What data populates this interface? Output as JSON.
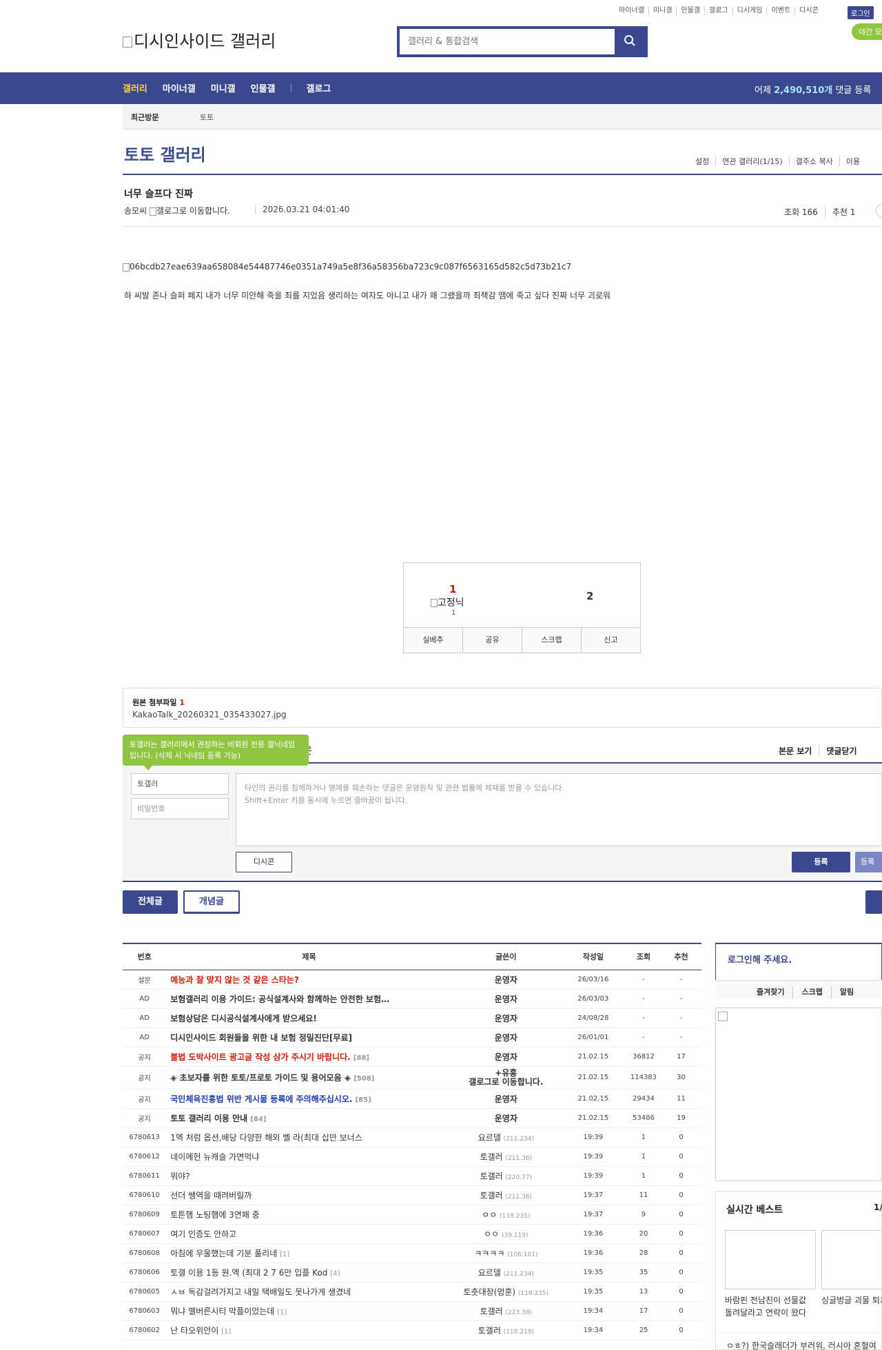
{
  "header": {
    "top_links": [
      "마이너갤",
      "미니갤",
      "인물갤",
      "갤로그",
      "디시게임",
      "이벤트",
      "디시콘"
    ],
    "login": "로그인",
    "night_mode": "야간 모드",
    "logo_alt": "디시인사이드 갤러리",
    "search_placeholder": "갤러리 & 통합검색"
  },
  "nav": {
    "items": [
      "갤러리",
      "마이너갤",
      "미니갤",
      "인물갤",
      "갤로그"
    ],
    "comment_count_prefix": "어제 ",
    "comment_count_value": "2,490,510개",
    "comment_count_suffix": " 댓글 등록"
  },
  "recent": {
    "label": "최근방문",
    "item": "토토"
  },
  "gallery": {
    "title": "토토 갤러리",
    "tools": [
      "설정",
      "연관 갤러리(1/15)",
      "갤주소 복사",
      "이용"
    ]
  },
  "post": {
    "title": "너무 슬프다 진짜",
    "author": "송모씨 ",
    "author_alt": "갤로그로 이동합니다.",
    "date": "2026.03.21 04:01:40",
    "views": "조회 166",
    "recommend": "추천 1",
    "image_alt": "06bcdb27eae639aa658084e54487746e0351a749a5e8f36a58356ba723c9c087f6563165d582c5d73b21c7",
    "body": "하 씨발 존나 슬퍼 페지 내가 너무 미안해 죽을 죄를 지었음 생리하는 여자도 아니고 내가 왜 그랬을까 죄책감 땜에 죽고 싶다 진짜 너무 괴로워"
  },
  "recommend_box": {
    "up_count": "1",
    "fixed_alt": "고정닉",
    "fixed_count": "1",
    "down_count": "2",
    "buttons": [
      "실베추",
      "공유",
      "스크랩",
      "신고"
    ]
  },
  "attachments": {
    "label": "원본 첨부파일 ",
    "count": "1",
    "file": "KakaoTalk_20260321_035433027.jpg"
  },
  "comment": {
    "tooltip": "토갤러는 갤러리에서 권장하는 비회원 전용 갤닉네임입니다. (삭제 시 닉네임 등록 가능)",
    "head_fragment": "은",
    "tools": [
      "본문 보기",
      "댓글닫기"
    ],
    "nickname": "토갤러",
    "password_placeholder": "비밀번호",
    "textarea_line1": "타인의 권리를 침해하거나 명예를 훼손하는 댓글은 운영원칙 및 관련 법률에 제재를 받을 수 있습니다.",
    "textarea_line2": "Shift+Enter 키를 동시에 누르면 줄바꿈이 됩니다.",
    "dccon": "디시콘",
    "submit": "등록",
    "submit2": "등록"
  },
  "list": {
    "tabs": [
      "전체글",
      "개념글"
    ],
    "headers": [
      "번호",
      "제목",
      "글쓴이",
      "작성일",
      "조회",
      "추천"
    ],
    "rows": [
      {
        "num": "설문",
        "title": "예능과 잘 맞지 않는 것 같은 스타는?",
        "reply": "",
        "writer": "운영자",
        "ip": "",
        "date": "26/03/16",
        "views": "-",
        "rec": "-",
        "style": "red",
        "notice": true
      },
      {
        "num": "AD",
        "title": "보험갤러리 이용 가이드: 공식설계사와 함께하는 안전한 보험…",
        "reply": "",
        "writer": "운영자",
        "ip": "",
        "date": "26/03/03",
        "views": "-",
        "rec": "-",
        "style": "",
        "notice": true
      },
      {
        "num": "AD",
        "title": "보험상담은 디시공식설계사에게 받으세요!",
        "reply": "",
        "writer": "운영자",
        "ip": "",
        "date": "24/08/28",
        "views": "-",
        "rec": "-",
        "style": "",
        "notice": true
      },
      {
        "num": "AD",
        "title": "디시인사이드 회원들을 위한 내 보험 정밀진단[무료]",
        "reply": "",
        "writer": "운영자",
        "ip": "",
        "date": "26/01/01",
        "views": "-",
        "rec": "-",
        "style": "",
        "notice": true
      },
      {
        "num": "공지",
        "title": "불법 도박사이트 광고글 작성 삼가 주시기 바랍니다.",
        "reply": "[88]",
        "writer": "운영자",
        "ip": "",
        "date": "21.02.15",
        "views": "36812",
        "rec": "17",
        "style": "red",
        "notice": true
      },
      {
        "num": "공지",
        "title": "◈ 초보자를 위한 토토/프로토 가이드 및 용어모음 ◈",
        "reply": "[508]",
        "writer": "+유흥",
        "writer2": "갤로그로 이동합니다.",
        "ip": "",
        "date": "21.02.15",
        "views": "114383",
        "rec": "30",
        "style": "",
        "notice": true,
        "tall": true
      },
      {
        "num": "공지",
        "title": "국민체육진흥법 위반 게시물 등록에 주의해주십시오.",
        "reply": "[85]",
        "writer": "운영자",
        "ip": "",
        "date": "21.02.15",
        "views": "29434",
        "rec": "11",
        "style": "blue",
        "notice": true
      },
      {
        "num": "공지",
        "title": "토토 갤러리 이용 안내",
        "reply": "[84]",
        "writer": "운영자",
        "ip": "",
        "date": "21.02.15",
        "views": "53486",
        "rec": "19",
        "style": "",
        "notice": true
      },
      {
        "num": "6780613",
        "title": "1엑 처럼 옵션,배당 다양한 해외 벨 라(최대 십만 보너스",
        "reply": "",
        "writer": "요르델",
        "ip": "(211.234)",
        "date": "19:39",
        "views": "1",
        "rec": "0",
        "style": "",
        "notice": false
      },
      {
        "num": "6780612",
        "title": "네이메헌 뉴캐슬 가면먹냐",
        "reply": "",
        "writer": "토갤러",
        "ip": "(211.36)",
        "date": "19:39",
        "views": "1",
        "rec": "0",
        "style": "",
        "notice": false
      },
      {
        "num": "6780611",
        "title": "뭐야?",
        "reply": "",
        "writer": "토갤러",
        "ip": "(220.77)",
        "date": "19:39",
        "views": "1",
        "rec": "0",
        "style": "",
        "notice": false
      },
      {
        "num": "6780610",
        "title": "선더 쌩역을 때려버릴까",
        "reply": "",
        "writer": "토갤러",
        "ip": "(211.36)",
        "date": "19:37",
        "views": "11",
        "rec": "0",
        "style": "",
        "notice": false
      },
      {
        "num": "6780609",
        "title": "토튼햄 노팅햄에 3연패 중",
        "reply": "",
        "writer": "ㅇㅇ",
        "ip": "(118.235)",
        "date": "19:37",
        "views": "9",
        "rec": "0",
        "style": "",
        "notice": false
      },
      {
        "num": "6780607",
        "title": "여기 인증도 안하고",
        "reply": "",
        "writer": "ㅇㅇ",
        "ip": "(39.119)",
        "date": "19:36",
        "views": "20",
        "rec": "0",
        "style": "",
        "notice": false
      },
      {
        "num": "6780608",
        "title": "아침에 우울했는데 기분 풀리네",
        "reply": "[1]",
        "writer": "ㅋㅋㅋㅋ",
        "ip": "(106.101)",
        "date": "19:36",
        "views": "28",
        "rec": "0",
        "style": "",
        "notice": false
      },
      {
        "num": "6780606",
        "title": "토갤 이용 1등 원.엑 (최대 2 7 6만 입플 Kod",
        "reply": "[4]",
        "writer": "요르델",
        "ip": "(211.234)",
        "date": "19:35",
        "views": "35",
        "rec": "0",
        "style": "",
        "notice": false
      },
      {
        "num": "6780605",
        "title": "ㅅㅂ 독감걸려가지고 내일 택배일도 못나가게 생겼네",
        "reply": "",
        "writer": "토춧대장(멍훈)",
        "ip": "(118.235)",
        "date": "19:35",
        "views": "13",
        "rec": "0",
        "style": "",
        "notice": false
      },
      {
        "num": "6780603",
        "title": "뭐냐 멜버른시티 막플이었는데",
        "reply": "[1]",
        "writer": "토갤러",
        "ip": "(223.38)",
        "date": "19:34",
        "views": "17",
        "rec": "0",
        "style": "",
        "notice": false
      },
      {
        "num": "6780602",
        "title": "난 타오위안이",
        "reply": "[1]",
        "writer": "토갤러",
        "ip": "(118.219)",
        "date": "19:34",
        "views": "25",
        "rec": "0",
        "style": "",
        "notice": false
      }
    ]
  },
  "sidebar": {
    "login_title": "로그인해 주세요.",
    "login_links": [
      "즐겨찾기",
      "스크랩",
      "알림"
    ],
    "best_title": "실시간 베스트",
    "best_page": "1/",
    "best_items": [
      "바람핀 전남친이 선물값 돌려달라고 연락이 왔다",
      "싱글벙글 괴물 퇴치 만화...jpg"
    ],
    "best_more": "ㅇㅎ?) 한국슬래더가 부러워, 러시아 혼혈여"
  },
  "colors": {
    "brand": "#3b4890",
    "accent_yellow": "#ffd331",
    "night_green": "#8fc541",
    "alert_red": "#d31900"
  }
}
